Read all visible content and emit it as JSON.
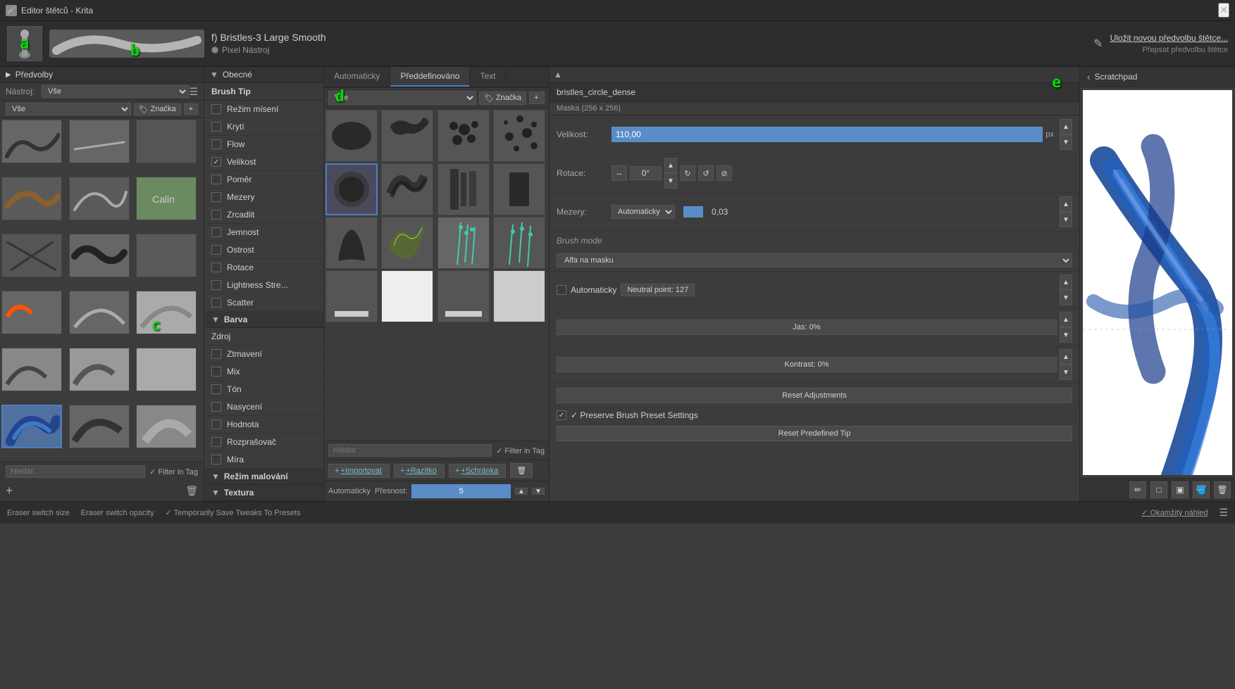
{
  "window": {
    "title": "Editor štětců - Krita",
    "close_label": "✕"
  },
  "top_bar": {
    "brush_name": "f) Bristles-3 Large Smooth",
    "pixel_label": "Pixel Nástroj",
    "edit_icon": "✎",
    "save_new_label": "Uložit novou předvolbu štětce...",
    "overwrite_label": "Přepsat předvolbu štětce"
  },
  "left_panel": {
    "presets_label": "Předvolby",
    "tool_label": "Nástroj:",
    "tool_value": "Vše",
    "filter_value": "Vše",
    "tag_label": "Značka",
    "search_placeholder": "Hledat",
    "filter_in_tag_label": "✓ Filter in Tag",
    "add_label": "+",
    "delete_label": "🗑"
  },
  "middle_panel": {
    "header_label": "Obecné",
    "items": [
      {
        "label": "Brush Tip",
        "checked": false,
        "is_section": true
      },
      {
        "label": "Režim mísení",
        "checked": false,
        "is_section": false
      },
      {
        "label": "Krytí",
        "checked": false,
        "is_section": false
      },
      {
        "label": "Flow",
        "checked": false,
        "is_section": false
      },
      {
        "label": "Velikost",
        "checked": true,
        "is_section": false
      },
      {
        "label": "Poměr",
        "checked": false,
        "is_section": false
      },
      {
        "label": "Mezery",
        "checked": false,
        "is_section": false
      },
      {
        "label": "Zrcadlit",
        "checked": false,
        "is_section": false
      },
      {
        "label": "Jemnost",
        "checked": false,
        "is_section": false
      },
      {
        "label": "Ostrost",
        "checked": false,
        "is_section": false
      },
      {
        "label": "Rotace",
        "checked": false,
        "is_section": false
      },
      {
        "label": "Lightness Stre...",
        "checked": false,
        "is_section": false
      },
      {
        "label": "Scatter",
        "checked": false,
        "is_section": false
      },
      {
        "label": "Barva",
        "checked": false,
        "is_section": true
      },
      {
        "label": "Zdroj",
        "checked": false,
        "is_section": false
      },
      {
        "label": "Ztmavení",
        "checked": false,
        "is_section": false
      },
      {
        "label": "Mix",
        "checked": false,
        "is_section": false
      },
      {
        "label": "Tón",
        "checked": false,
        "is_section": false
      },
      {
        "label": "Nasycení",
        "checked": false,
        "is_section": false
      },
      {
        "label": "Hodnota",
        "checked": false,
        "is_section": false
      },
      {
        "label": "Rozprašovač",
        "checked": false,
        "is_section": false
      },
      {
        "label": "Míra",
        "checked": false,
        "is_section": false
      },
      {
        "label": "Režim malování",
        "checked": false,
        "is_section": true
      },
      {
        "label": "Textura",
        "checked": false,
        "is_section": true
      }
    ]
  },
  "brush_tips_panel": {
    "tabs": [
      "Automaticky",
      "Předdefinováno",
      "Text"
    ],
    "active_tab": "Předdefinováno",
    "filter_value": "Vše",
    "tag_btn_label": "Značka",
    "tips": [
      {
        "name": "tip1",
        "selected": false
      },
      {
        "name": "tip2",
        "selected": false
      },
      {
        "name": "tip3",
        "selected": false
      },
      {
        "name": "tip4",
        "selected": false
      },
      {
        "name": "tip5",
        "selected": true
      },
      {
        "name": "tip6",
        "selected": false
      },
      {
        "name": "tip7",
        "selected": false
      },
      {
        "name": "tip8",
        "selected": false
      },
      {
        "name": "tip9",
        "selected": false
      },
      {
        "name": "tip10",
        "selected": false
      },
      {
        "name": "tip11",
        "selected": false
      },
      {
        "name": "tip12",
        "selected": false
      },
      {
        "name": "tip13",
        "selected": false
      },
      {
        "name": "tip14",
        "selected": false
      },
      {
        "name": "tip15",
        "selected": false
      },
      {
        "name": "tip16",
        "selected": false
      }
    ],
    "search_placeholder": "Hledat",
    "filter_in_tag_label": "✓ Filter in Tag",
    "import_label": "+Importovat",
    "stamp_label": "+Razítko",
    "clipboard_label": "+Schránka",
    "delete_label": "🗑",
    "auto_label": "Automaticky",
    "precision_label": "Přesnost:",
    "precision_value": "5"
  },
  "brush_settings_panel": {
    "brush_name": "bristles_circle_dense",
    "mask_info": "Maska (256 x 256)",
    "size_label": "Velikost:",
    "size_value": "110,00",
    "size_unit": "px",
    "rotation_label": "Rotace:",
    "rotation_value": "0°",
    "spacing_label": "Mezery:",
    "spacing_mode": "Automaticky",
    "spacing_value": "0,03",
    "brush_mode_label": "Brush mode",
    "brush_mode_value": "Alfa na masku",
    "auto_label": "Automaticky",
    "neutral_label": "Neutral point: 127",
    "jas_label": "Jas: 0%",
    "kontrast_label": "Kontrast: 0%",
    "reset_adjustments_label": "Reset Adjustments",
    "preserve_label": "✓ Preserve Brush Preset Settings",
    "reset_predefined_label": "Reset Predefined Tip"
  },
  "scratchpad": {
    "title": "Scratchpad",
    "arrow_label": "‹"
  },
  "footer": {
    "eraser_size_label": "Eraser switch size",
    "eraser_opacity_label": "Eraser switch opacity",
    "save_tweaks_label": "✓ Temporarily Save Tweaks To Presets",
    "instant_preview_label": "✓ Okamžitý náhled",
    "menu_icon": "☰"
  },
  "annotations": {
    "a_label": "a",
    "b_label": "b",
    "c_label": "c",
    "d_label": "d",
    "e_label": "e"
  }
}
